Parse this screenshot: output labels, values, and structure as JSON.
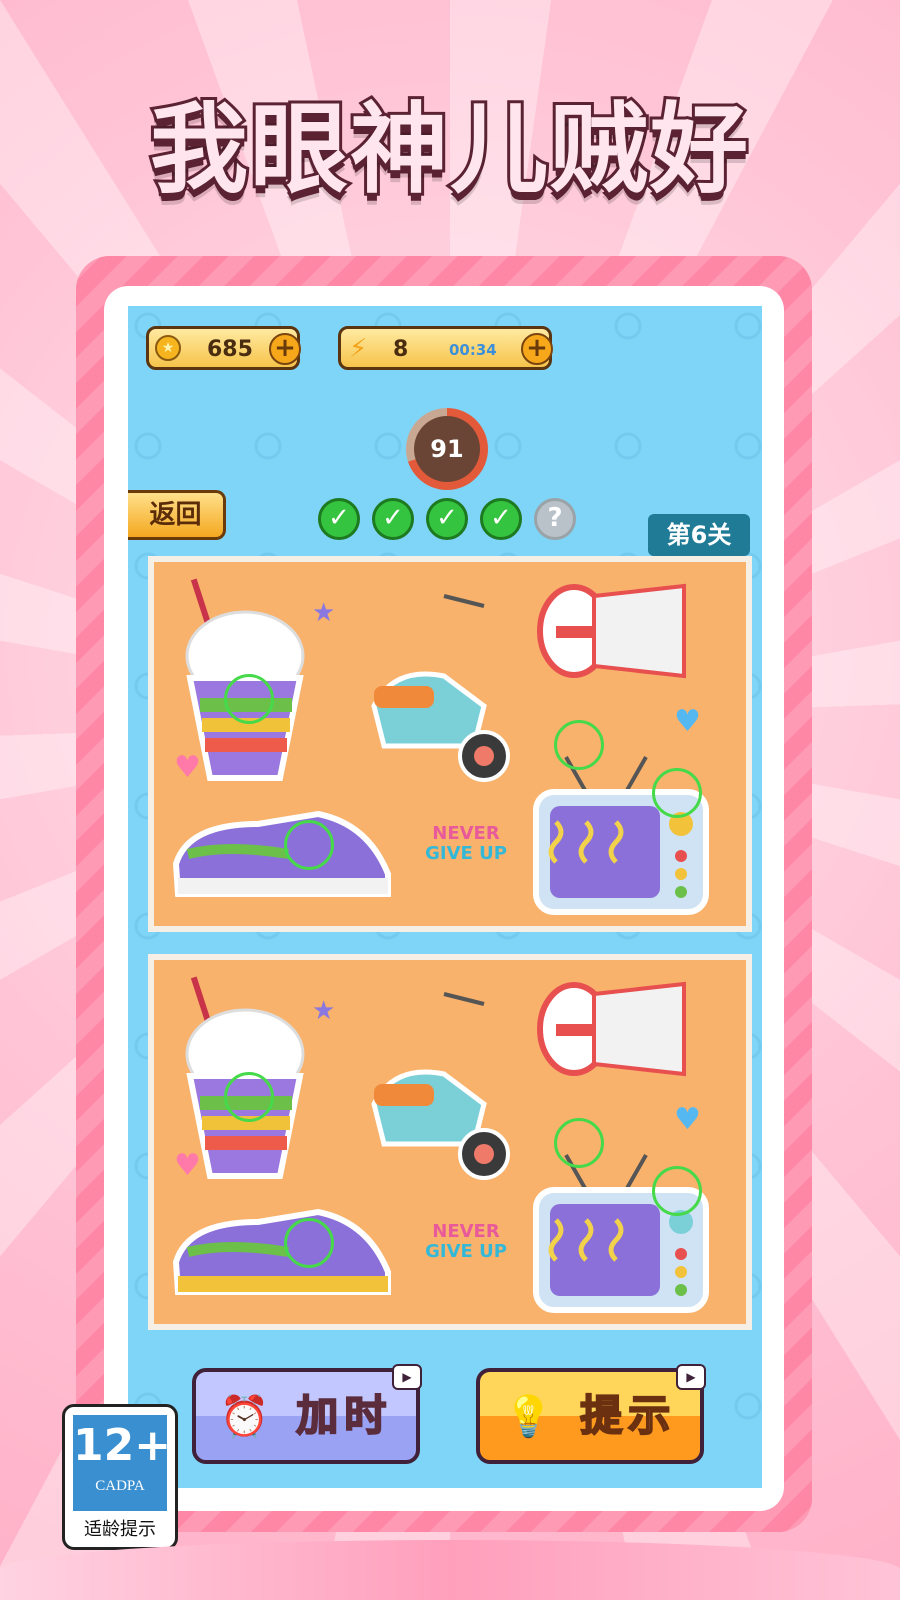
{
  "title": "我眼神儿贼好",
  "hud": {
    "coins": "685",
    "energy": "8",
    "energy_timer": "00:34",
    "score": "91",
    "back_label": "返回",
    "level_label": "第6关"
  },
  "progress_checks": [
    {
      "state": "found",
      "glyph": "✓"
    },
    {
      "state": "found",
      "glyph": "✓"
    },
    {
      "state": "found",
      "glyph": "✓"
    },
    {
      "state": "found",
      "glyph": "✓"
    },
    {
      "state": "unknown",
      "glyph": "?"
    }
  ],
  "stickers": {
    "slogan_line1": "NEVER",
    "slogan_line2": "GIVE UP"
  },
  "buttons": {
    "add_time_label": "加时",
    "hint_label": "提示"
  },
  "age_rating": {
    "number": "12+",
    "org": "CADPA",
    "caption": "适龄提示"
  },
  "colors": {
    "frame_pink": "#ff8aa8",
    "game_bg": "#7fd5f7",
    "panel_orange": "#f8b26c",
    "found_green": "#35c43f",
    "level_tag": "#1f7b96"
  }
}
